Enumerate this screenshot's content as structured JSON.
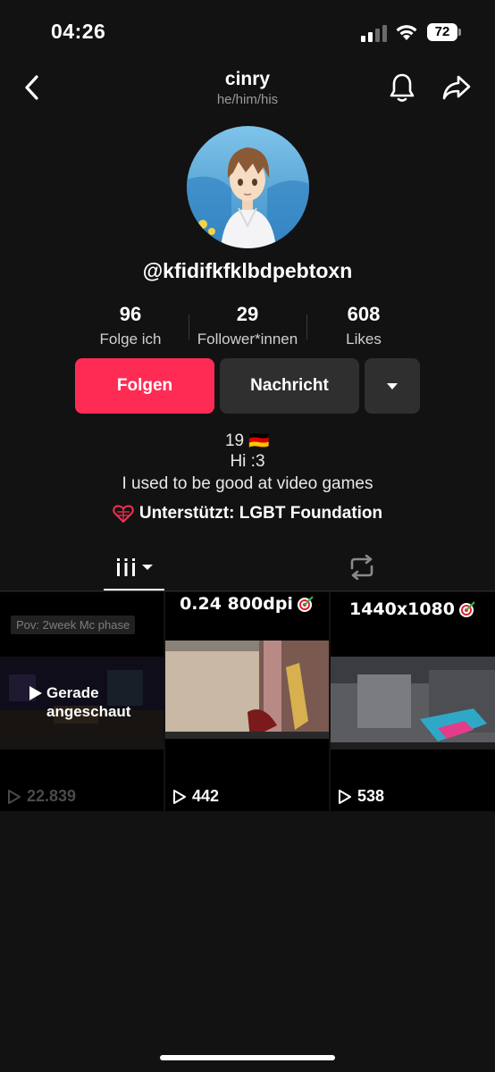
{
  "status_bar": {
    "time": "04:26",
    "battery": "72"
  },
  "header": {
    "name": "cinry",
    "pronouns": "he/him/his",
    "back_icon": "chevron-left-icon",
    "bell_icon": "bell-icon",
    "share_icon": "share-arrow-icon"
  },
  "profile": {
    "username": "@kfidifkfklbdpebtoxn",
    "stats": [
      {
        "value": "96",
        "label": "Folge ich"
      },
      {
        "value": "29",
        "label": "Follower*innen"
      },
      {
        "value": "608",
        "label": "Likes"
      }
    ],
    "buttons": {
      "follow": "Folgen",
      "message": "Nachricht"
    },
    "bio": {
      "line1": "19 🇩🇪",
      "line2": "Hi :3",
      "line3": "I used to be good at video games"
    },
    "support": "Unterstützt: LGBT Foundation"
  },
  "colors": {
    "accent": "#fe2c55",
    "background": "#121212",
    "button_secondary": "#2f2f2f"
  },
  "tabs": {
    "videos_icon": "grid-icon",
    "reposts_icon": "repost-icon"
  },
  "videos": [
    {
      "caption": "Pov: 2week Mc phase",
      "watched_label_1": "Gerade",
      "watched_label_2": "angeschaut",
      "views": "22.839"
    },
    {
      "title": "0.24 800dpi",
      "views": "442"
    },
    {
      "title": "1440x1080",
      "views": "538"
    }
  ]
}
